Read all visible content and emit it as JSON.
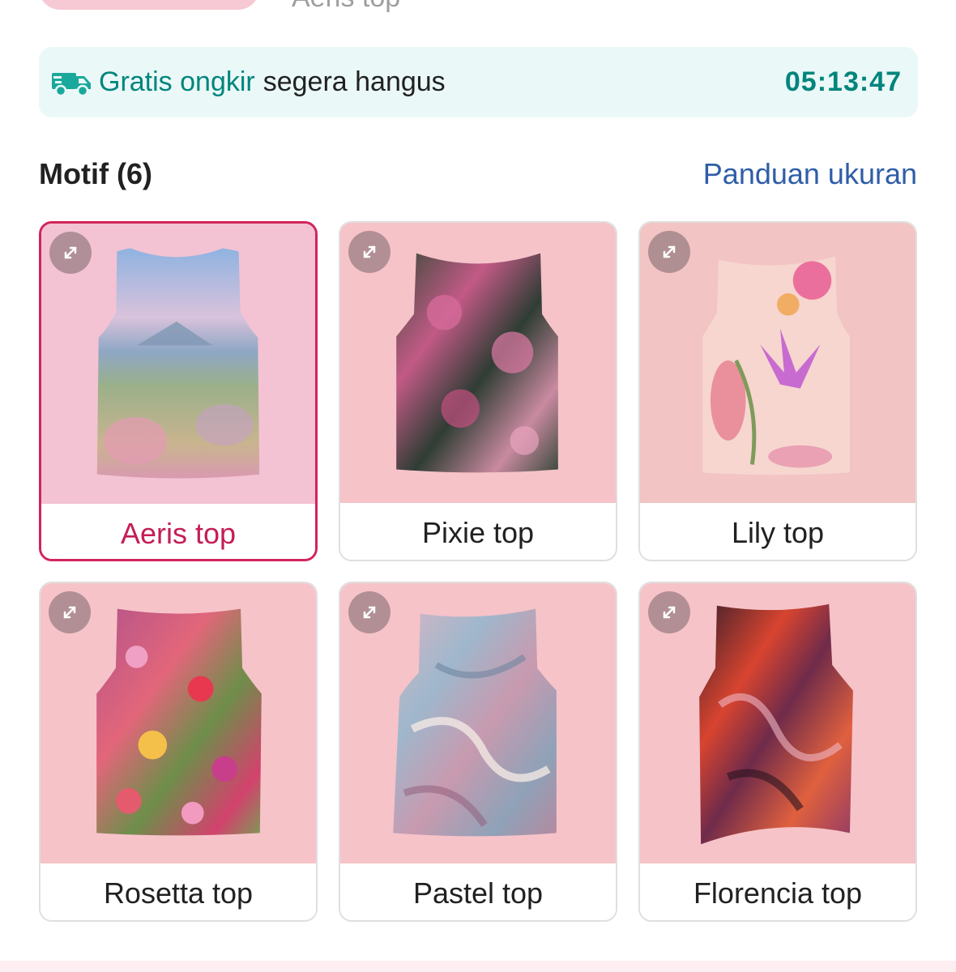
{
  "previous": {
    "label": "Aeris top"
  },
  "banner": {
    "highlight": "Gratis ongkir",
    "text": "segera hangus",
    "timer": "05:13:47",
    "icon": "truck-icon",
    "accent_color": "#00857c",
    "background_color": "#ebf8f8"
  },
  "section": {
    "title": "Motif (6)",
    "link": "Panduan ukuran"
  },
  "motifs": [
    {
      "label": "Aeris top",
      "selected": true,
      "bg": "#f3c3d3"
    },
    {
      "label": "Pixie top",
      "selected": false,
      "bg": "#f6c3c9"
    },
    {
      "label": "Lily top",
      "selected": false,
      "bg": "#f2c4c4"
    },
    {
      "label": "Rosetta top",
      "selected": false,
      "bg": "#f6c3c9"
    },
    {
      "label": "Pastel top",
      "selected": false,
      "bg": "#f6c3c9"
    },
    {
      "label": "Florencia top",
      "selected": false,
      "bg": "#f6c3c9"
    }
  ],
  "colors": {
    "selected_border": "#d2245b",
    "link": "#2f5ea8"
  }
}
